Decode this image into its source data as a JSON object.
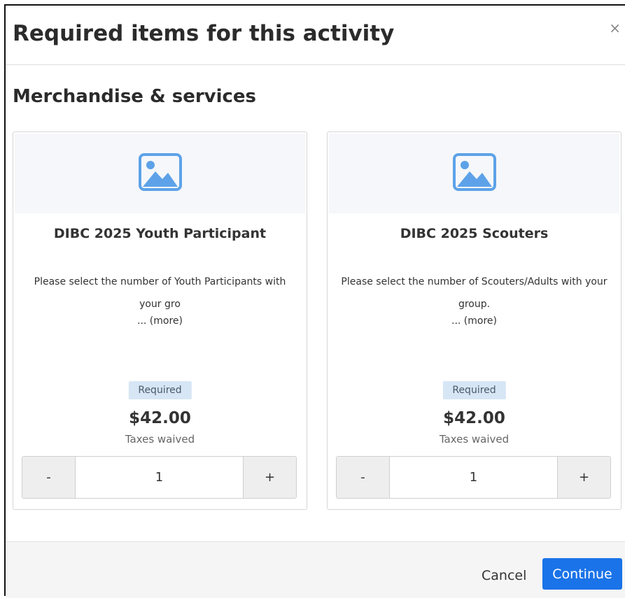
{
  "modal": {
    "title": "Required items for this activity",
    "close_icon": "×"
  },
  "section": {
    "title": "Merchandise & services"
  },
  "items": [
    {
      "icon": "image-placeholder-icon",
      "title": "DIBC 2025 Youth Participant",
      "description": "Please select the number of Youth Participants with your gro",
      "more": "... (more)",
      "badge": "Required",
      "price": "$42.00",
      "taxes": "Taxes waived",
      "minus": "-",
      "quantity": "1",
      "plus": "+"
    },
    {
      "icon": "image-placeholder-icon",
      "title": "DIBC 2025 Scouters",
      "description": "Please select the number of Scouters/Adults with your group.",
      "more": "... (more)",
      "badge": "Required",
      "price": "$42.00",
      "taxes": "Taxes waived",
      "minus": "-",
      "quantity": "1",
      "plus": "+"
    }
  ],
  "footer": {
    "cancel_label": "Cancel",
    "continue_label": "Continue"
  },
  "colors": {
    "accent": "#1a73e8",
    "badge_bg": "#d7e6f5",
    "image_icon": "#5da2e8"
  }
}
